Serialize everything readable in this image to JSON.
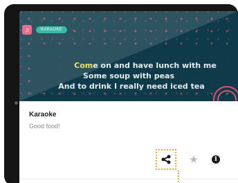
{
  "card": {
    "badge_text": "KARAOKE",
    "lyrics": {
      "line1_highlight": "Com",
      "line1_rest": "e on and have lunch with me",
      "line2": "Some soup with peas",
      "line3": "And to drink I really need iced tea"
    },
    "title": "Karaoke",
    "subtitle": "Good food!"
  },
  "actions": {
    "share_icon": "share-icon",
    "favorite_icon": "star-icon",
    "info_icon": "info-icon",
    "info_glyph": "i"
  },
  "colors": {
    "thumbnail_bg": "#0e3b49",
    "lyric_highlight": "#f1de45",
    "pill": "#1fae9c",
    "accent_pink": "#e3506f",
    "focus_outline": "#f2b21b"
  }
}
